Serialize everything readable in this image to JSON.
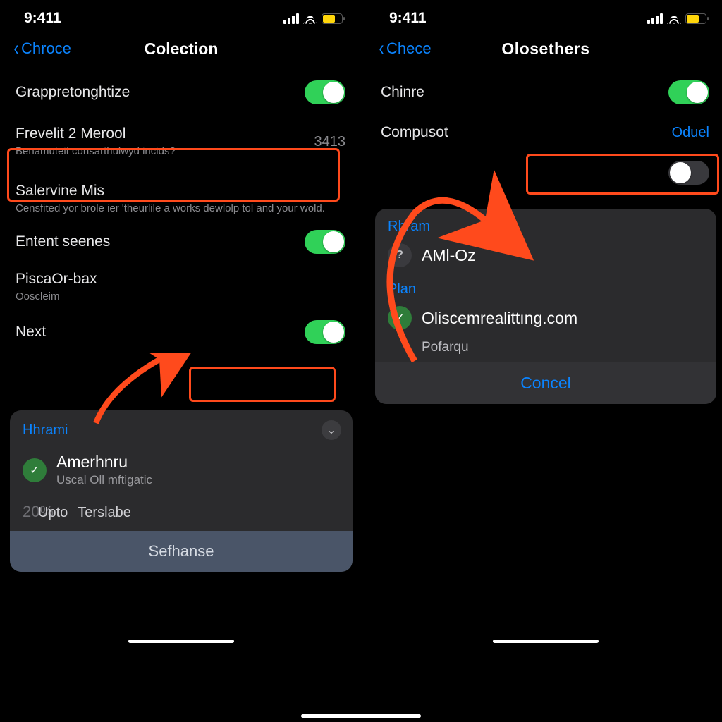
{
  "status": {
    "time": "9:411"
  },
  "left": {
    "back": "Chroce",
    "title": "Colection",
    "rows": {
      "r1": {
        "label": "Grappretonghtize"
      },
      "r2": {
        "label": "Frevelit 2 Merool",
        "sub": "Benamuteit consarthulwyd incids?",
        "value": "3413"
      },
      "r3": {
        "label": "Salervine Mis",
        "sub": "Censfited yor brole ier 'theurlile a works dewlolp tol and your wold."
      },
      "r4": {
        "label": "Entent seenes"
      },
      "r5": {
        "label": "PiscaOr-bax",
        "sub": "Ooscleim"
      },
      "r6": {
        "label": "Next"
      }
    },
    "sheet": {
      "header": "Hhrami",
      "opt_title": "Amerhnru",
      "opt_sub": "Uscal Oll mftigatic",
      "ghost": "20%",
      "foot_a": "Upto",
      "foot_b": "Terslabe",
      "button": "Sefhanse"
    }
  },
  "right": {
    "back": "Chece",
    "title": "Olosethers",
    "rows": {
      "r1": {
        "label": "Chinre"
      },
      "r2": {
        "label": "Compusot",
        "value": "Oduel"
      }
    },
    "sheet": {
      "h1": "Rhram",
      "opt1": "AMl-Oz",
      "h2": "Plan",
      "opt2": "Oliscemrealittıng.com",
      "opt3": "Pofarqu",
      "cancel": "Concel"
    }
  }
}
